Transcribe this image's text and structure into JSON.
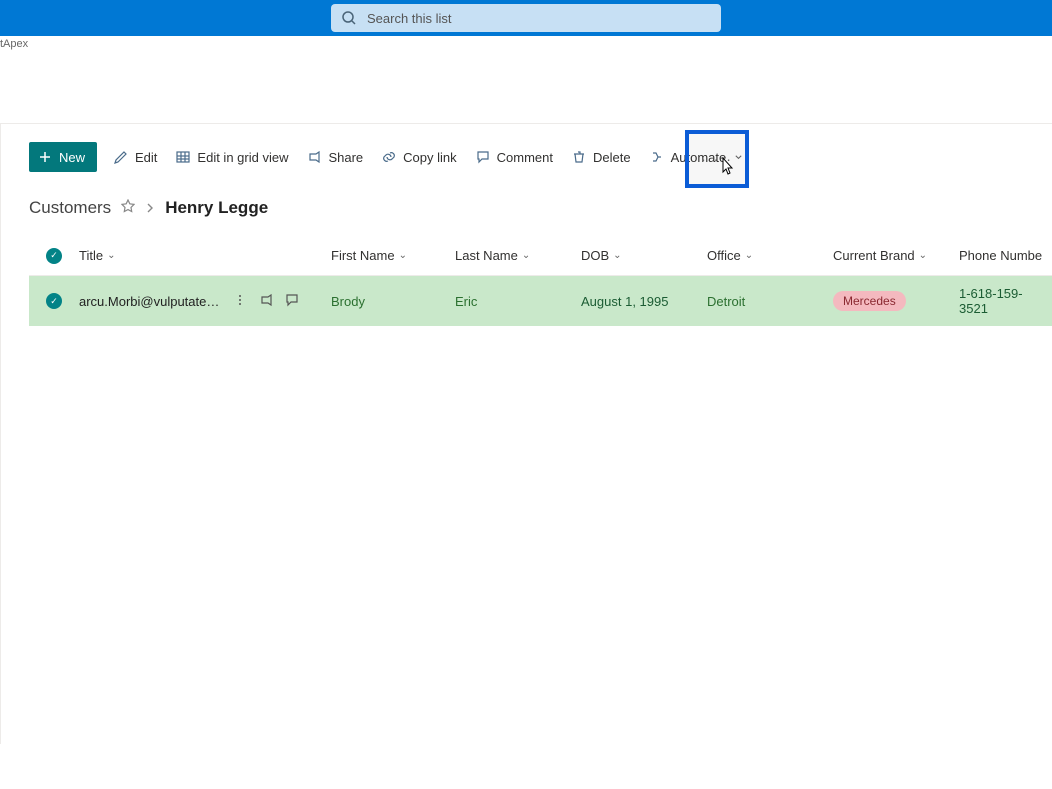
{
  "header": {
    "search_placeholder": "Search this list"
  },
  "small_breadcrumb": "tApex",
  "toolbar": {
    "new": "New",
    "edit": "Edit",
    "edit_grid": "Edit in grid view",
    "share": "Share",
    "copy_link": "Copy link",
    "comment": "Comment",
    "delete": "Delete",
    "automate": "Automate"
  },
  "breadcrumb": {
    "root": "Customers",
    "current": "Henry Legge"
  },
  "columns": {
    "title": "Title",
    "first_name": "First Name",
    "last_name": "Last Name",
    "dob": "DOB",
    "office": "Office",
    "current_brand": "Current Brand",
    "phone": "Phone Numbe"
  },
  "rows": [
    {
      "title": "arcu.Morbi@vulputatedu…",
      "first_name": "Brody",
      "last_name": "Eric",
      "dob": "August 1, 1995",
      "office": "Detroit",
      "brand": "Mercedes",
      "phone": "1-618-159-3521"
    }
  ]
}
